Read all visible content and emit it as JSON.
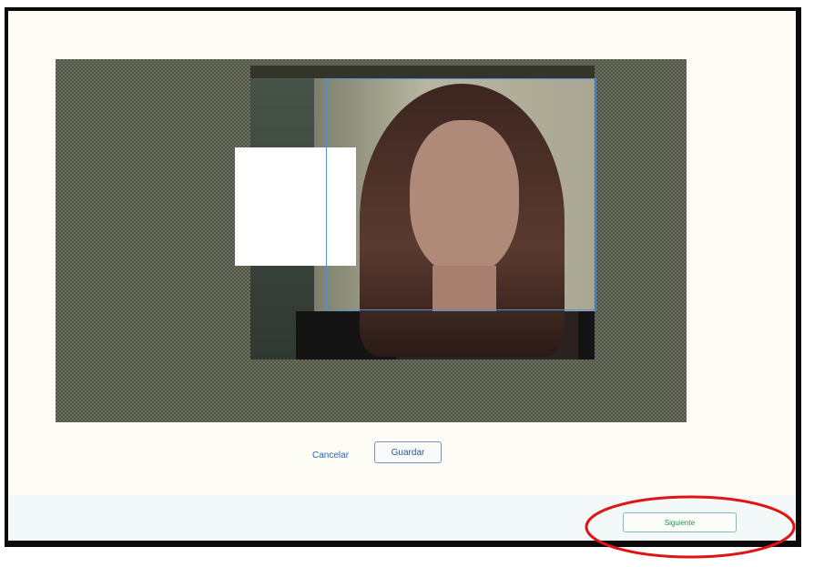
{
  "dialog": {
    "cancel_label": "Cancelar",
    "save_label": "Guardar",
    "next_label": "Siguiente"
  },
  "colors": {
    "link": "#2d64b8",
    "selection_border": "#4f8fd6",
    "highlight_ellipse": "#e01414",
    "next_text": "#2e8a5a"
  },
  "annotation": {
    "shape": "red ellipse",
    "target": "next-button"
  }
}
